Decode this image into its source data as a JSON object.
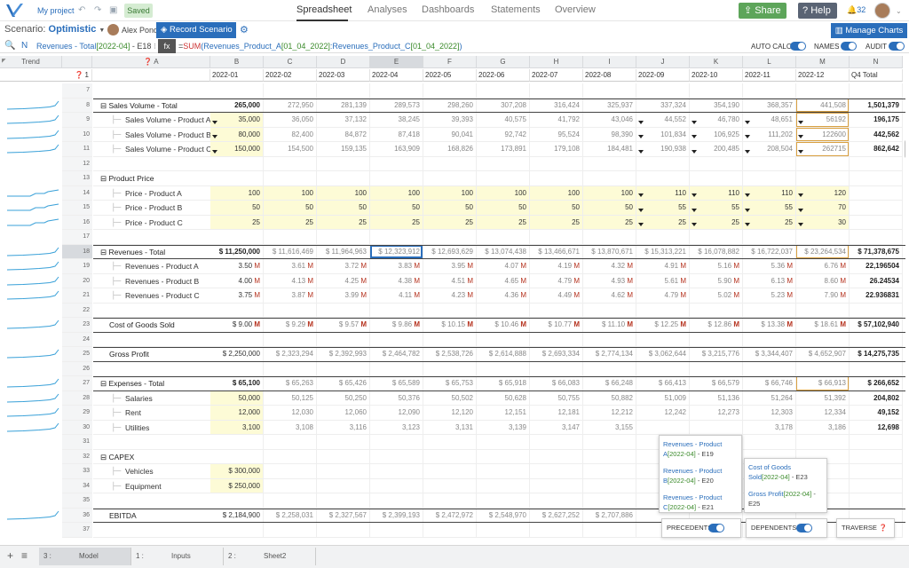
{
  "topbar": {
    "project": "My project",
    "saved": "Saved",
    "tabs": [
      "Spreadsheet",
      "Analyses",
      "Dashboards",
      "Statements",
      "Overview"
    ],
    "share": "Share",
    "help": "Help",
    "notifications": "32"
  },
  "scenario": {
    "label": "Scenario:",
    "value": "Optimistic",
    "user": "Alex Pond",
    "record": "Record Scenario",
    "manage_charts": "Manage Charts"
  },
  "formula_bar": {
    "ref_prefix": "Revenues - Total",
    "ref_date": "[2022-04]",
    "ref_cell": "- E18",
    "fx": "fx",
    "formula_eq": "=",
    "formula_fn": "SUM",
    "formula_arg1": "(Revenues_Product_A",
    "formula_arg1_idx": "[01_04_2022]",
    "formula_arg2": ":Revenues_Product_C",
    "formula_arg2_idx": "[01_04_2022]",
    "formula_end": ")",
    "auto_calc": "AUTO CALC",
    "names": "NAMES",
    "audit": "AUDIT"
  },
  "grid": {
    "trend_header": "Trend",
    "col_letters": [
      "A",
      "B",
      "C",
      "D",
      "E",
      "F",
      "G",
      "H",
      "I",
      "J",
      "K",
      "L",
      "M",
      "N"
    ],
    "periods": [
      "2022-01",
      "2022-02",
      "2022-03",
      "2022-04",
      "2022-05",
      "2022-06",
      "2022-07",
      "2022-08",
      "2022-09",
      "2022-10",
      "2022-11",
      "2022-12",
      "Q4 Total"
    ],
    "header_row_num": "1",
    "rows": [
      {
        "num": "7",
        "label": "",
        "cells": []
      },
      {
        "num": "8",
        "label": "⊟ Sales Volume - Total",
        "cells": [
          "265,000",
          "272,950",
          "281,139",
          "289,573",
          "298,260",
          "307,208",
          "316,424",
          "325,937",
          "337,324",
          "354,190",
          "368,357",
          "441,508",
          "1,501,379"
        ]
      },
      {
        "num": "9",
        "label": "Sales Volume - Product A",
        "cells": [
          "35,000",
          "36,050",
          "37,132",
          "38,245",
          "39,393",
          "40,575",
          "41,792",
          "43,046",
          "44,552",
          "46,780",
          "48,651",
          "56192",
          "196,175"
        ]
      },
      {
        "num": "10",
        "label": "Sales Volume - Product B",
        "cells": [
          "80,000",
          "82,400",
          "84,872",
          "87,418",
          "90,041",
          "92,742",
          "95,524",
          "98,390",
          "101,834",
          "106,925",
          "111,202",
          "122600",
          "442,562"
        ]
      },
      {
        "num": "11",
        "label": "Sales Volume - Product C",
        "cells": [
          "150,000",
          "154,500",
          "159,135",
          "163,909",
          "168,826",
          "173,891",
          "179,108",
          "184,481",
          "190,938",
          "200,485",
          "208,504",
          "262715",
          "862,642"
        ]
      },
      {
        "num": "12",
        "label": "",
        "cells": []
      },
      {
        "num": "13",
        "label": "⊟ Product Price",
        "cells": []
      },
      {
        "num": "14",
        "label": "Price - Product A",
        "cells": [
          "100",
          "100",
          "100",
          "100",
          "100",
          "100",
          "100",
          "100",
          "110",
          "110",
          "110",
          "120",
          ""
        ]
      },
      {
        "num": "15",
        "label": "Price - Product B",
        "cells": [
          "50",
          "50",
          "50",
          "50",
          "50",
          "50",
          "50",
          "50",
          "55",
          "55",
          "55",
          "70",
          ""
        ]
      },
      {
        "num": "16",
        "label": "Price - Product C",
        "cells": [
          "25",
          "25",
          "25",
          "25",
          "25",
          "25",
          "25",
          "25",
          "25",
          "25",
          "25",
          "30",
          ""
        ]
      },
      {
        "num": "17",
        "label": "",
        "cells": []
      },
      {
        "num": "18",
        "label": "⊟ Revenues - Total",
        "cells": [
          "$ 11,250,000",
          "$ 11,616,469",
          "$ 11,964,963",
          "$ 12,323,912",
          "$ 12,693,629",
          "$ 13,074,438",
          "$ 13,466,671",
          "$ 13,870,671",
          "$ 15,313,221",
          "$ 16,078,882",
          "$ 16,722,037",
          "$ 23,264,534",
          "$ 71,378,675"
        ]
      },
      {
        "num": "19",
        "label": "Revenues - Product A",
        "cells": [
          "3.50",
          "3.61",
          "3.72",
          "3.83",
          "3.95",
          "4.07",
          "4.19",
          "4.32",
          "4.91",
          "5.16",
          "5.36",
          "6.76",
          "22,196504"
        ]
      },
      {
        "num": "20",
        "label": "Revenues - Product B",
        "cells": [
          "4.00",
          "4.13",
          "4.25",
          "4.38",
          "4.51",
          "4.65",
          "4.79",
          "4.93",
          "5.61",
          "5.90",
          "6.13",
          "8.60",
          "26.24534"
        ]
      },
      {
        "num": "21",
        "label": "Revenues - Product C",
        "cells": [
          "3.75",
          "3.87",
          "3.99",
          "4.11",
          "4.23",
          "4.36",
          "4.49",
          "4.62",
          "4.79",
          "5.02",
          "5.23",
          "7.90",
          "22.936831"
        ]
      },
      {
        "num": "22",
        "label": "",
        "cells": []
      },
      {
        "num": "23",
        "label": "Cost of Goods Sold",
        "cells": [
          "$ 9.00",
          "$ 9.29",
          "$ 9.57",
          "$ 9.86",
          "$ 10.15",
          "$ 10.46",
          "$ 10.77",
          "$ 11.10",
          "$ 12.25",
          "$ 12.86",
          "$ 13.38",
          "$ 18.61",
          "$ 57,102,940"
        ]
      },
      {
        "num": "24",
        "label": "",
        "cells": []
      },
      {
        "num": "25",
        "label": "Gross Profit",
        "cells": [
          "$ 2,250,000",
          "$ 2,323,294",
          "$ 2,392,993",
          "$ 2,464,782",
          "$ 2,538,726",
          "$ 2,614,888",
          "$ 2,693,334",
          "$ 2,774,134",
          "$ 3,062,644",
          "$ 3,215,776",
          "$ 3,344,407",
          "$ 4,652,907",
          "$ 14,275,735"
        ]
      },
      {
        "num": "26",
        "label": "",
        "cells": []
      },
      {
        "num": "27",
        "label": "⊟ Expenses - Total",
        "cells": [
          "$ 65,100",
          "$ 65,263",
          "$ 65,426",
          "$ 65,589",
          "$ 65,753",
          "$ 65,918",
          "$ 66,083",
          "$ 66,248",
          "$ 66,413",
          "$ 66,579",
          "$ 66,746",
          "$ 66,913",
          "$ 266,652"
        ]
      },
      {
        "num": "28",
        "label": "Salaries",
        "cells": [
          "50,000",
          "50,125",
          "50,250",
          "50,376",
          "50,502",
          "50,628",
          "50,755",
          "50,882",
          "51,009",
          "51,136",
          "51,264",
          "51,392",
          "204,802"
        ]
      },
      {
        "num": "29",
        "label": "Rent",
        "cells": [
          "12,000",
          "12,030",
          "12,060",
          "12,090",
          "12,120",
          "12,151",
          "12,181",
          "12,212",
          "12,242",
          "12,273",
          "12,303",
          "12,334",
          "49,152"
        ]
      },
      {
        "num": "30",
        "label": "Utilities",
        "cells": [
          "3,100",
          "3,108",
          "3,116",
          "3,123",
          "3,131",
          "3,139",
          "3,147",
          "3,155",
          "",
          "",
          "3,178",
          "3,186",
          "12,698"
        ]
      },
      {
        "num": "31",
        "label": "",
        "cells": []
      },
      {
        "num": "32",
        "label": "⊟ CAPEX",
        "cells": []
      },
      {
        "num": "33",
        "label": "Vehicles",
        "cells": [
          "$ 300,000",
          "",
          "",
          "",
          "",
          "",
          "",
          "",
          "",
          "",
          "",
          "",
          ""
        ]
      },
      {
        "num": "34",
        "label": "Equipment",
        "cells": [
          "$ 250,000",
          "",
          "",
          "",
          "",
          "",
          "",
          "",
          "",
          "",
          "",
          "",
          ""
        ]
      },
      {
        "num": "35",
        "label": "",
        "cells": []
      },
      {
        "num": "36",
        "label": "EBITDA",
        "cells": [
          "$ 2,184,900",
          "$ 2,258,031",
          "$ 2,327,567",
          "$ 2,399,193",
          "$ 2,472,972",
          "$ 2,548,970",
          "$ 2,627,252",
          "$ 2,707,886",
          "",
          "",
          "",
          "",
          ""
        ]
      },
      {
        "num": "37",
        "label": "",
        "cells": []
      }
    ]
  },
  "precedents": [
    {
      "name": "Revenues - Product A",
      "date": "[2022-04]",
      "cell": "- E19"
    },
    {
      "name": "Revenues - Product B",
      "date": "[2022-04]",
      "cell": "- E20"
    },
    {
      "name": "Revenues - Product C",
      "date": "[2022-04]",
      "cell": "- E21"
    }
  ],
  "dependents": [
    {
      "name": "Cost of Goods Sold",
      "date": "[2022-04]",
      "cell": "- E23"
    },
    {
      "name": "Gross Profit",
      "date": "[2022-04]",
      "cell": "- E25"
    }
  ],
  "audit_footer": {
    "precedents": "PRECEDENTS",
    "dependents": "DEPENDENTS",
    "traverse": "TRAVERSE"
  },
  "sheet_tabs": [
    {
      "num": "3 :",
      "name": "Model"
    },
    {
      "num": "1 :",
      "name": "Inputs"
    },
    {
      "num": "2 :",
      "name": "Sheet2"
    }
  ],
  "colors": {
    "accent": "#2a6ebb",
    "share": "#5da55a",
    "help": "#5a6474",
    "input_fill": "#fdfbd6",
    "money_m": "#b5321e"
  }
}
